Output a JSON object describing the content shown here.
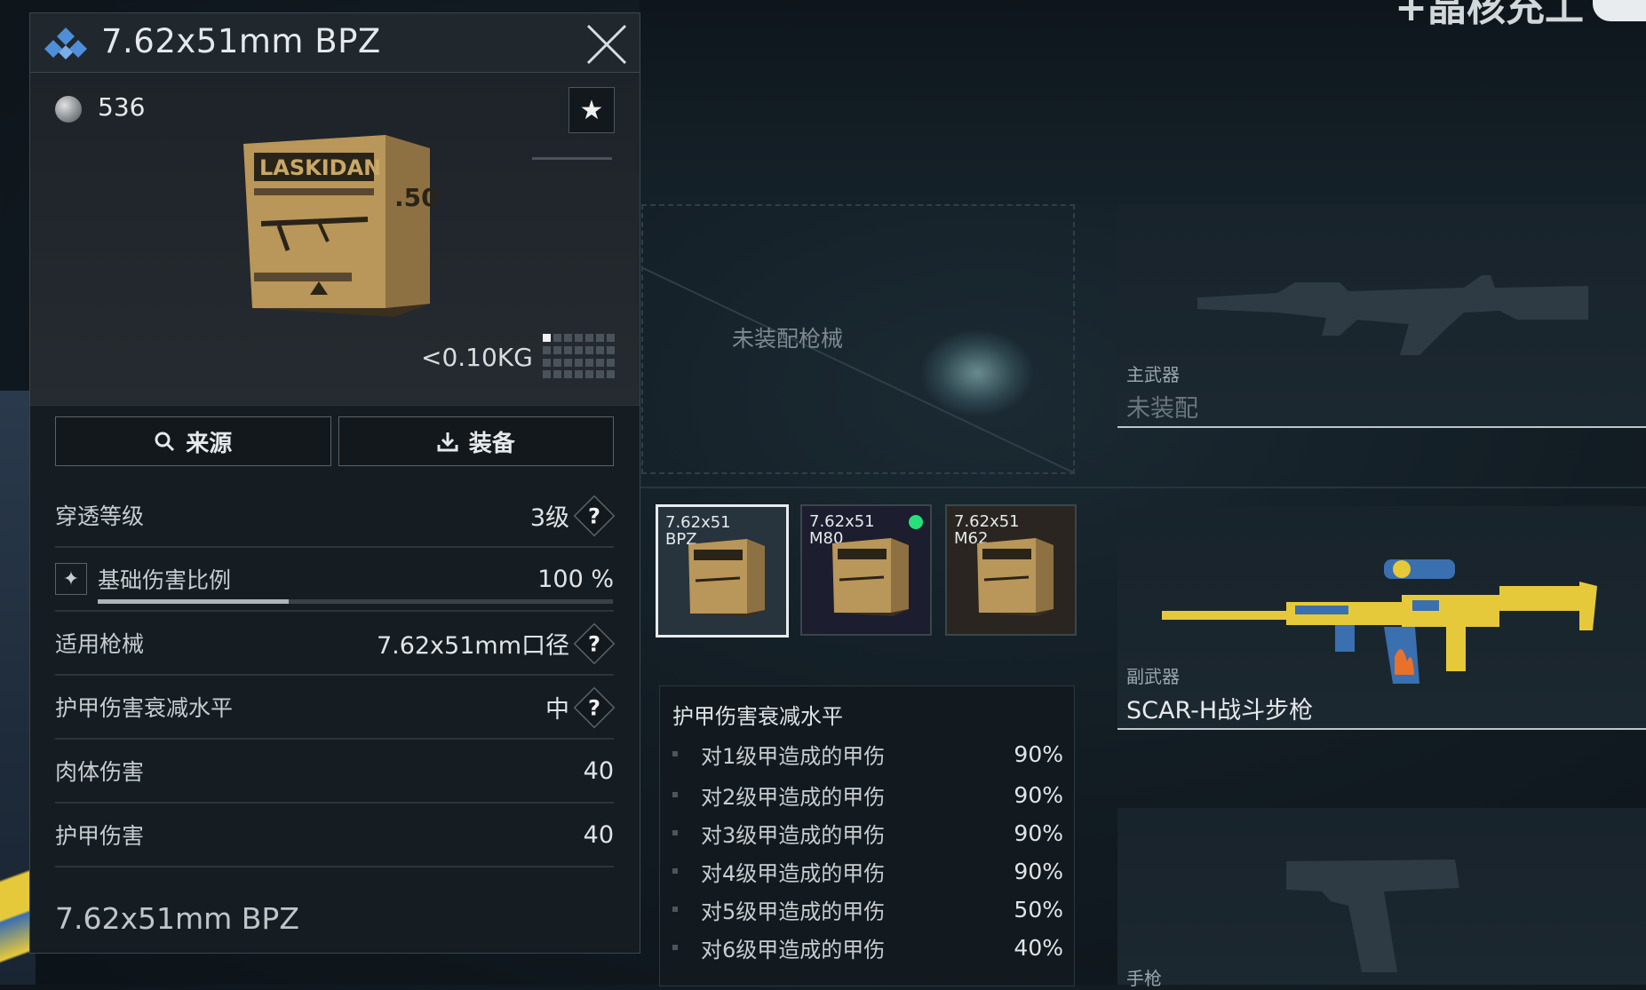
{
  "top_corner": {
    "text": "+晶核充工"
  },
  "detail_panel": {
    "title": "7.62x51mm BPZ",
    "price": "536",
    "weight": "<0.10KG",
    "box_brand": "LASKIDAN",
    "box_caliber": ".50",
    "buttons": {
      "source": "来源",
      "equip": "装备"
    },
    "stats": {
      "penetration": {
        "label": "穿透等级",
        "value": "3级"
      },
      "base_damage": {
        "label": "基础伤害比例",
        "value": "100 %",
        "fill_fraction": 0.37
      },
      "compatible": {
        "label": "适用枪械",
        "value": "7.62x51mm口径"
      },
      "armor_falloff": {
        "label": "护甲伤害衰减水平",
        "value": "中"
      },
      "flesh_damage": {
        "label": "肉体伤害",
        "value": "40"
      },
      "armor_damage": {
        "label": "护甲伤害",
        "value": "40"
      }
    },
    "footer": "7.62x51mm BPZ"
  },
  "empty_weapon_slot": {
    "label": "未装配枪械"
  },
  "ammo_options": [
    {
      "line1": "7.62x51",
      "line2": "BPZ",
      "selected": true,
      "equipped": false
    },
    {
      "line1": "7.62x51",
      "line2": "M80",
      "selected": false,
      "equipped": true
    },
    {
      "line1": "7.62x51",
      "line2": "M62",
      "selected": false,
      "equipped": false
    }
  ],
  "armor_reduction": {
    "title": "护甲伤害衰减水平",
    "rows": [
      {
        "label": "对1级甲造成的甲伤",
        "value": "90%"
      },
      {
        "label": "对2级甲造成的甲伤",
        "value": "90%"
      },
      {
        "label": "对3级甲造成的甲伤",
        "value": "90%"
      },
      {
        "label": "对4级甲造成的甲伤",
        "value": "90%"
      },
      {
        "label": "对5级甲造成的甲伤",
        "value": "50%"
      },
      {
        "label": "对6级甲造成的甲伤",
        "value": "40%"
      }
    ]
  },
  "weapon_slots": {
    "primary": {
      "label": "主武器",
      "value": "未装配"
    },
    "secondary": {
      "label": "副武器",
      "value": "SCAR-H战斗步枪"
    },
    "pistol": {
      "label": "手枪"
    }
  },
  "colors": {
    "equipped_dot": "#27e07a",
    "rifle_yellow": "#e6c93a",
    "rifle_blue": "#3a6fb0"
  }
}
